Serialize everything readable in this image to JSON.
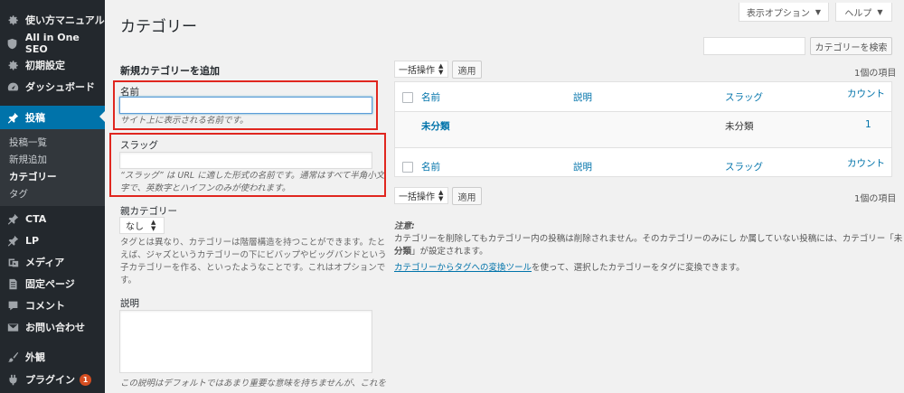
{
  "sidebar": {
    "items": [
      {
        "label": "使い方マニュアル",
        "icon": "gear-icon"
      },
      {
        "label": "All in One SEO",
        "icon": "shield-icon"
      },
      {
        "label": "初期設定",
        "icon": "gear-icon"
      },
      {
        "label": "ダッシュボード",
        "icon": "dashboard-icon"
      },
      {
        "label": "投稿",
        "icon": "pin-icon"
      },
      {
        "label": "CTA",
        "icon": "pin-icon"
      },
      {
        "label": "LP",
        "icon": "pin-icon"
      },
      {
        "label": "メディア",
        "icon": "media-icon"
      },
      {
        "label": "固定ページ",
        "icon": "page-icon"
      },
      {
        "label": "コメント",
        "icon": "comment-icon"
      },
      {
        "label": "お問い合わせ",
        "icon": "mail-icon"
      },
      {
        "label": "外観",
        "icon": "brush-icon"
      },
      {
        "label": "プラグイン",
        "icon": "plugin-icon"
      }
    ],
    "submenu": [
      "投稿一覧",
      "新規追加",
      "カテゴリー",
      "タグ"
    ],
    "plugin_badge": "1"
  },
  "top": {
    "screen_options": "表示オプション",
    "help": "ヘルプ"
  },
  "page_title": "カテゴリー",
  "search": {
    "value": "",
    "button": "カテゴリーを検索"
  },
  "form": {
    "heading": "新規カテゴリーを追加",
    "name_label": "名前",
    "name_desc": "サイト上に表示される名前です。",
    "slug_label": "スラッグ",
    "slug_desc_1": "“スラッグ” は URL に適した形式の名前です。通常はすべて半角小文",
    "slug_desc_2": "字で、英数字とハイフンのみが使われます。",
    "parent_label": "親カテゴリー",
    "parent_value": "なし",
    "parent_desc_1": "タグとは異なり、カテゴリーは階層構造を持つことができます。たと",
    "parent_desc_2": "えば、ジャズというカテゴリーの下にビバップやビッグバンドという",
    "parent_desc_3": "子カテゴリーを作る、といったようなことです。これはオプションで",
    "parent_desc_4": "す。",
    "description_label": "説明",
    "description_desc": "この説明はデフォルトではあまり重要な意味を持ちませんが、これを"
  },
  "table": {
    "bulk_action": "一括操作",
    "apply": "適用",
    "count": "1個の項目",
    "headers": {
      "name": "名前",
      "description": "説明",
      "slug": "スラッグ",
      "count": "カウント"
    },
    "rows": [
      {
        "name": "未分類",
        "description": "",
        "slug": "未分類",
        "count": "1"
      }
    ]
  },
  "notes": {
    "label": "注意:",
    "line1": "カテゴリーを削除してもカテゴリー内の投稿は削除されません。そのカテゴリーのみにし か属していない投稿には、カテゴリー「未",
    "line2_bold": "分類",
    "line2_rest": "」が設定されます。",
    "link": "カテゴリーからタグへの変換ツール",
    "line3_rest": "を使って、選択したカテゴリーをタグに変換できます。"
  },
  "colors": {
    "sidebar_bg": "#23282d",
    "active_bg": "#0073aa",
    "link": "#0073aa",
    "highlight_box": "#e0261f",
    "badge": "#d54e21"
  }
}
